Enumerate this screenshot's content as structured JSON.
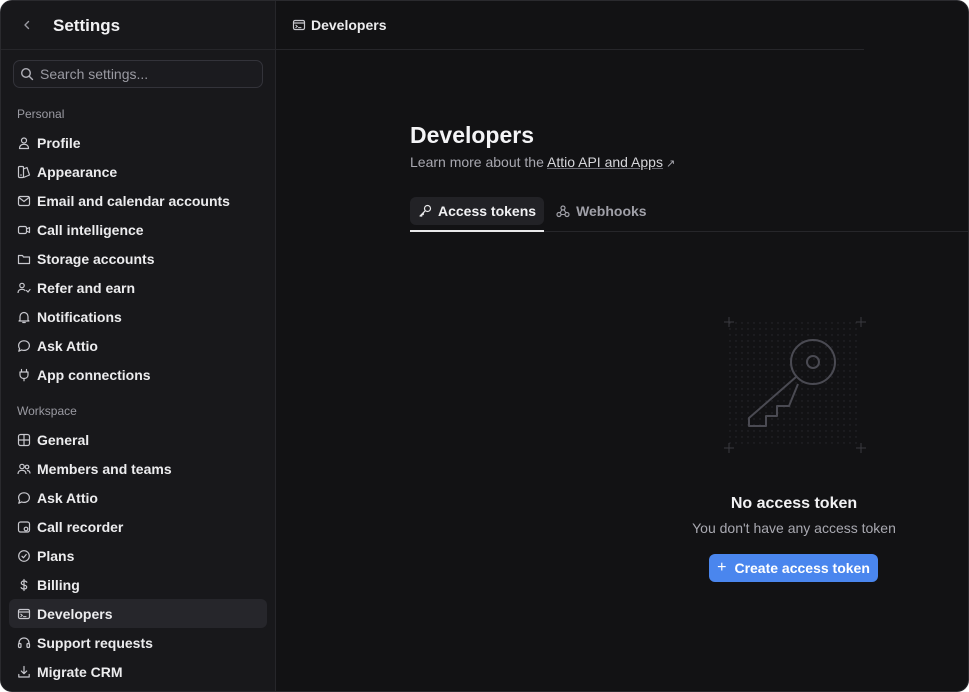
{
  "sidebar": {
    "title": "Settings",
    "search_placeholder": "Search settings...",
    "personal_label": "Personal",
    "personal_items": [
      {
        "label": "Profile",
        "icon": "user-icon"
      },
      {
        "label": "Appearance",
        "icon": "palette-icon"
      },
      {
        "label": "Email and calendar accounts",
        "icon": "mail-icon"
      },
      {
        "label": "Call intelligence",
        "icon": "video-icon"
      },
      {
        "label": "Storage accounts",
        "icon": "folder-icon"
      },
      {
        "label": "Refer and earn",
        "icon": "users-gift-icon"
      },
      {
        "label": "Notifications",
        "icon": "bell-icon"
      },
      {
        "label": "Ask Attio",
        "icon": "chat-icon"
      },
      {
        "label": "App connections",
        "icon": "plug-icon"
      }
    ],
    "workspace_label": "Workspace",
    "workspace_items": [
      {
        "label": "General",
        "icon": "grid-icon"
      },
      {
        "label": "Members and teams",
        "icon": "team-icon"
      },
      {
        "label": "Ask Attio",
        "icon": "chat-icon"
      },
      {
        "label": "Call recorder",
        "icon": "recorder-icon"
      },
      {
        "label": "Plans",
        "icon": "badge-icon"
      },
      {
        "label": "Billing",
        "icon": "dollar-icon"
      },
      {
        "label": "Developers",
        "icon": "terminal-icon",
        "active": true
      },
      {
        "label": "Support requests",
        "icon": "headset-icon"
      },
      {
        "label": "Migrate CRM",
        "icon": "download-icon"
      }
    ]
  },
  "main": {
    "breadcrumb": "Developers",
    "title": "Developers",
    "subtitle_prefix": "Learn more about the",
    "subtitle_link": "Attio API and Apps",
    "subtitle_arrow": "↗",
    "tabs": [
      {
        "label": "Access tokens",
        "icon": "key-icon",
        "active": true
      },
      {
        "label": "Webhooks",
        "icon": "webhook-icon",
        "active": false
      }
    ],
    "empty_state": {
      "title": "No access token",
      "subtitle": "You don't have any access token",
      "button_label": "Create access token",
      "button_icon": "+"
    }
  },
  "colors": {
    "background": "#121214",
    "sidebar": "#18181b",
    "accent": "#4a86ee"
  }
}
